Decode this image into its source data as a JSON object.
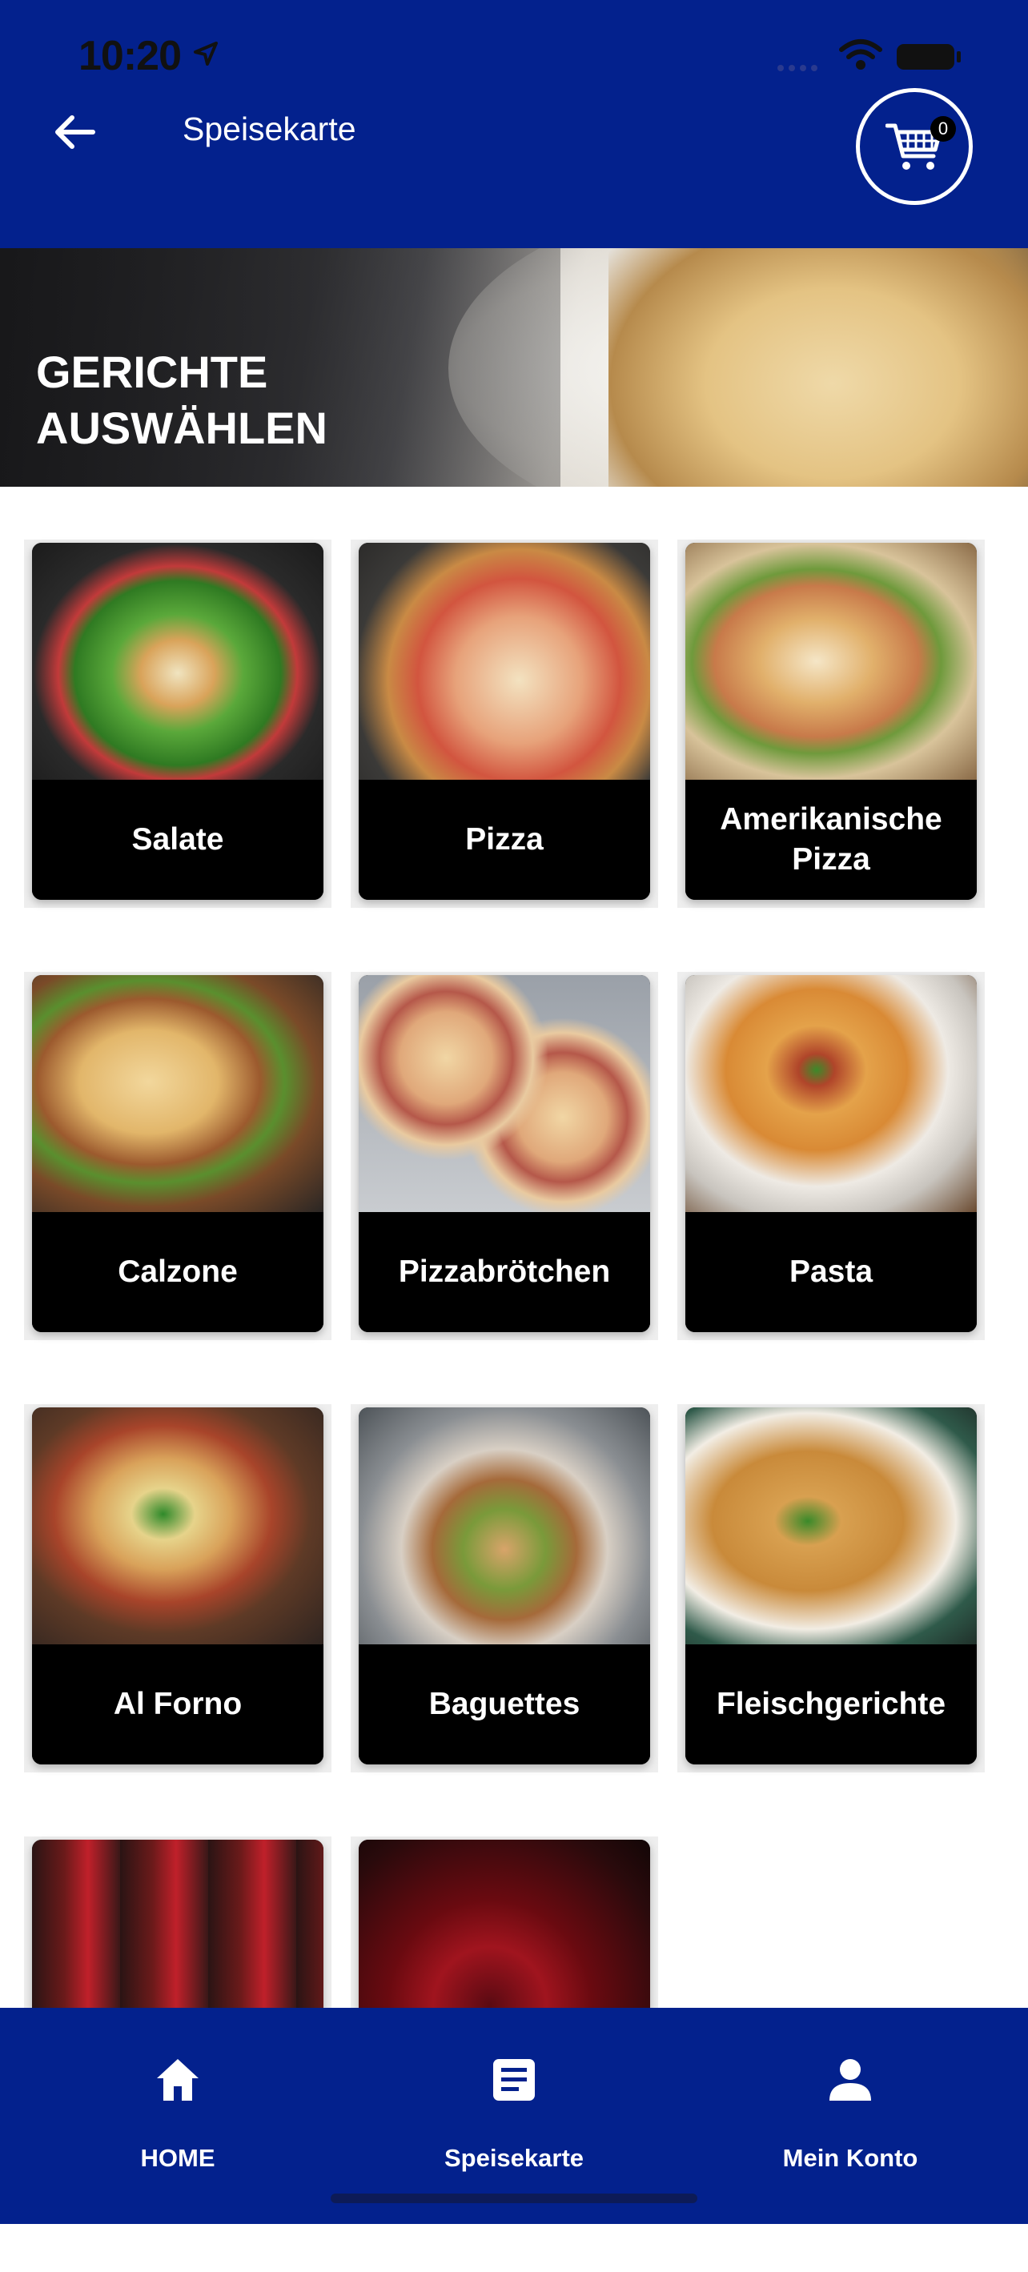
{
  "status_bar": {
    "time": "10:20"
  },
  "header": {
    "title": "Speisekarte",
    "cart_count": "0"
  },
  "banner": {
    "title": "GERICHTE AUSWÄHLEN"
  },
  "categories": [
    {
      "label": "Salate"
    },
    {
      "label": "Pizza"
    },
    {
      "label": "Amerikanische Pizza"
    },
    {
      "label": "Calzone"
    },
    {
      "label": "Pizzabrötchen"
    },
    {
      "label": "Pasta"
    },
    {
      "label": "Al Forno"
    },
    {
      "label": "Baguettes"
    },
    {
      "label": "Fleischgerichte"
    },
    {
      "label": ""
    },
    {
      "label": ""
    }
  ],
  "tabbar": {
    "home": "HOME",
    "menu": "Speisekarte",
    "account": "Mein Konto"
  },
  "colors": {
    "primary": "#03218d",
    "card_label_bg": "#000000"
  }
}
